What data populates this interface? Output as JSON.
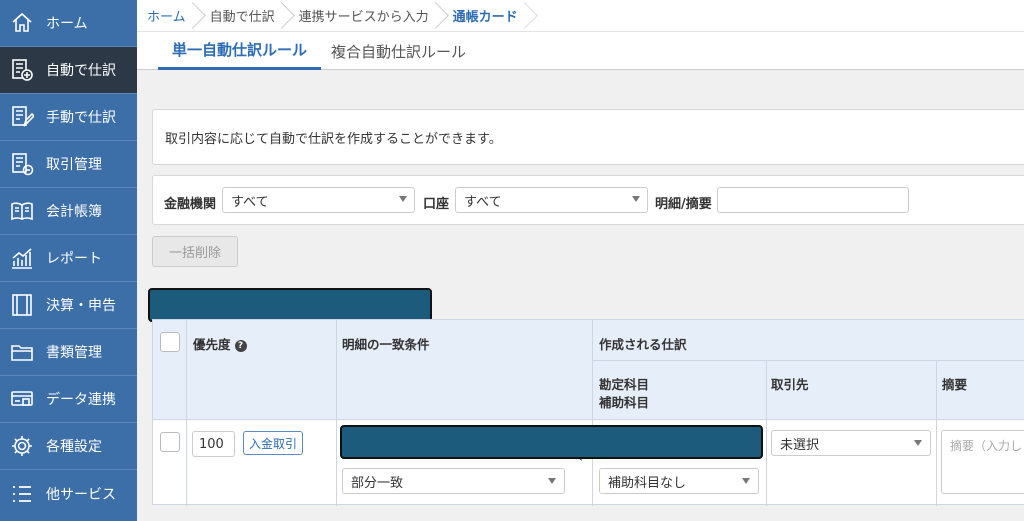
{
  "sidebar": {
    "items": [
      {
        "label": "ホーム",
        "icon": "home-icon",
        "active": false
      },
      {
        "label": "自動で仕訳",
        "icon": "auto-journal-icon",
        "active": true
      },
      {
        "label": "手動で仕訳",
        "icon": "manual-journal-icon",
        "active": false
      },
      {
        "label": "取引管理",
        "icon": "transaction-icon",
        "active": false
      },
      {
        "label": "会計帳簿",
        "icon": "ledger-book-icon",
        "active": false
      },
      {
        "label": "レポート",
        "icon": "report-chart-icon",
        "active": false
      },
      {
        "label": "決算・申告",
        "icon": "settlement-icon",
        "active": false
      },
      {
        "label": "書類管理",
        "icon": "folder-icon",
        "active": false
      },
      {
        "label": "データ連携",
        "icon": "card-icon",
        "active": false
      },
      {
        "label": "各種設定",
        "icon": "gear-icon",
        "active": false
      },
      {
        "label": "他サービス",
        "icon": "list-icon",
        "active": false
      }
    ]
  },
  "breadcrumb": [
    "ホーム",
    "自動で仕訳",
    "連携サービスから入力",
    "通帳カード"
  ],
  "tabs": [
    "単一自動仕訳ルール",
    "複合自動仕訳ルール"
  ],
  "info_text": "取引内容に応じて自動で仕訳を作成することができます。",
  "filter": {
    "institution_label": "金融機関",
    "institution_value": "すべて",
    "account_label": "口座",
    "account_value": "すべて",
    "detail_label": "明細/摘要",
    "detail_value": ""
  },
  "bulk_delete_label": "一括削除",
  "table": {
    "headers": {
      "priority": "優先度",
      "match_condition": "明細の一致条件",
      "created_entry": "作成される仕訳",
      "account_item": "勘定科目",
      "sub_account": "補助科目",
      "partner": "取引先",
      "memo": "摘要"
    },
    "help_glyph": "?",
    "rows": [
      {
        "priority": "100",
        "type_tag": "入金取引",
        "match_mode": "部分一致",
        "sub_account": "補助科目なし",
        "partner": "未選択",
        "memo_placeholder": "摘要（入力し"
      }
    ]
  }
}
